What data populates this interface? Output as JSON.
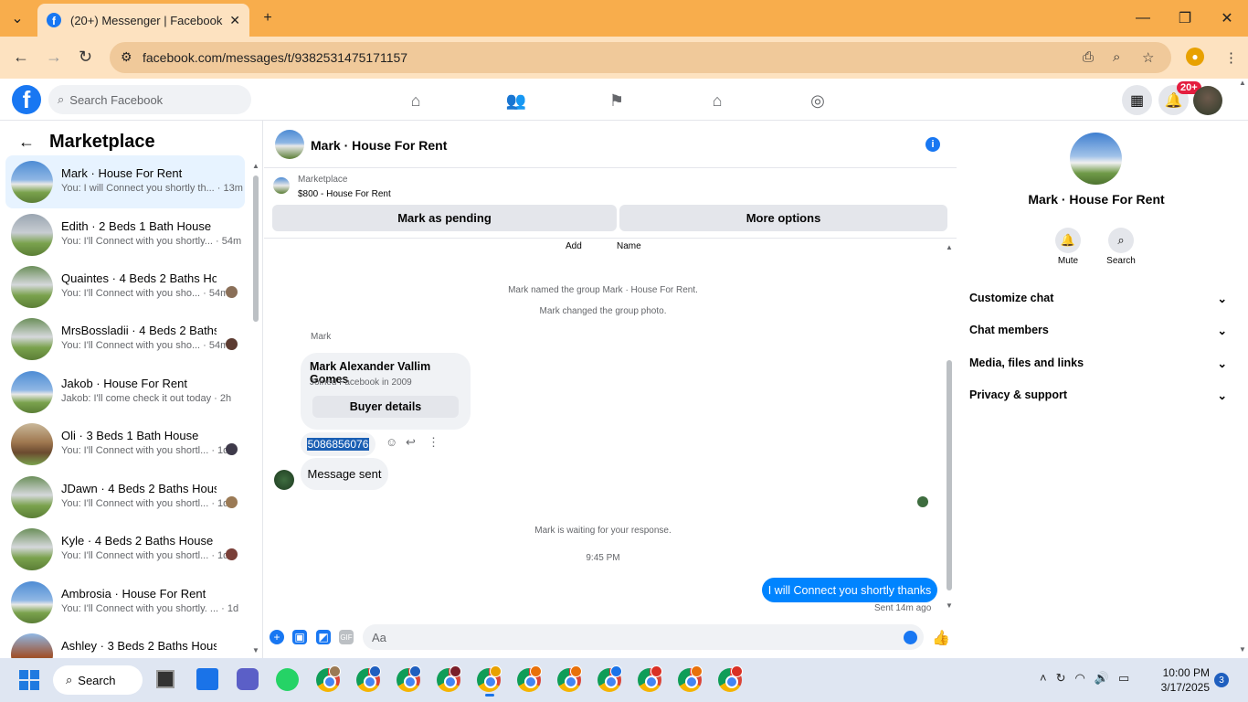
{
  "browser": {
    "tab_title": "(20+) Messenger | Facebook",
    "url": "facebook.com/messages/t/9382531475171157"
  },
  "facebook": {
    "search_placeholder": "Search Facebook",
    "notif_badge": "20+"
  },
  "left": {
    "title": "Marketplace",
    "conversations": [
      {
        "name": "Mark · House For Rent",
        "snippet": "You: I will Connect you shortly th... · 13m"
      },
      {
        "name": "Edith · 2 Beds 1 Bath House",
        "snippet": "You: I'll Connect with you shortly... · 54m"
      },
      {
        "name": "Quaintes · 4 Beds 2 Baths Ho...",
        "snippet": "You: I'll Connect with you sho... · 54m"
      },
      {
        "name": "MrsBossladii · 4 Beds 2 Baths ...",
        "snippet": "You: I'll Connect with you sho... · 54m"
      },
      {
        "name": "Jakob · House For Rent",
        "snippet": "Jakob: I'll come check it out today · 2h"
      },
      {
        "name": "Oli · 3 Beds 1 Bath House",
        "snippet": "You: I'll Connect with you shortl... · 1d"
      },
      {
        "name": "JDawn · 4 Beds 2 Baths House",
        "snippet": "You: I'll Connect with you shortl... · 1d"
      },
      {
        "name": "Kyle · 4 Beds 2 Baths House",
        "snippet": "You: I'll Connect with you shortl... · 1d"
      },
      {
        "name": "Ambrosia · House For Rent",
        "snippet": "You: I'll Connect with you shortly. ... · 1d"
      },
      {
        "name": "Ashley · 3 Beds 2 Baths House",
        "snippet": ""
      }
    ]
  },
  "chat": {
    "title": "Mark · House For Rent",
    "marketplace_label": "Marketplace",
    "listing": "$800 - House For Rent",
    "mark_pending": "Mark as pending",
    "more_options": "More options",
    "add_label": "Add",
    "name_label": "Name",
    "event1": "Mark named the group Mark · House For Rent.",
    "event2": "Mark changed the group photo.",
    "sender": "Mark",
    "buyer_name": "Mark Alexander Vallim Gomes",
    "buyer_joined": "Joined Facebook in 2009",
    "buyer_details": "Buyer details",
    "phone": "5086856076",
    "message_sent": "Message sent",
    "waiting": "Mark is waiting for your response.",
    "time": "9:45 PM",
    "my_message": "I will Connect you shortly thanks",
    "sent_status": "Sent 14m ago",
    "composer_placeholder": "Aa"
  },
  "right": {
    "title": "Mark · House For Rent",
    "mute": "Mute",
    "search": "Search",
    "sections": [
      "Customize chat",
      "Chat members",
      "Media, files and links",
      "Privacy & support"
    ]
  },
  "taskbar": {
    "search": "Search",
    "time": "10:00 PM",
    "date": "3/17/2025",
    "notifications": "3"
  }
}
